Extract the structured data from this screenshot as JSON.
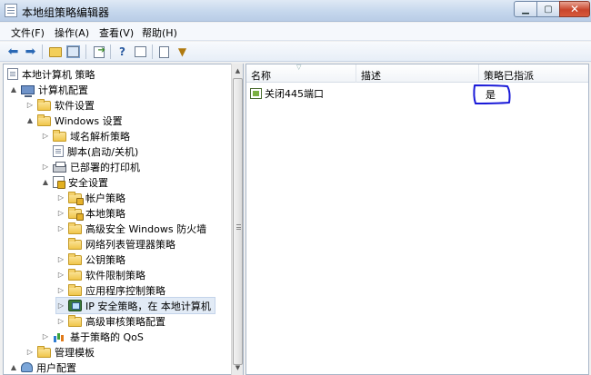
{
  "window": {
    "title": "本地组策略编辑器"
  },
  "menu": [
    {
      "label": "文件(F)"
    },
    {
      "label": "操作(A)"
    },
    {
      "label": "查看(V)"
    },
    {
      "label": "帮助(H)"
    }
  ],
  "toolbar": {
    "back_icon": "back-arrow-icon",
    "forward_icon": "forward-arrow-icon"
  },
  "tree": {
    "items": [
      {
        "label": "本地计算机 策略",
        "icon": "doc-icon",
        "expander": ""
      },
      {
        "label": "计算机配置",
        "icon": "computer-icon",
        "expander": "▲"
      },
      {
        "label": "软件设置",
        "icon": "folder-icon",
        "expander": "▷"
      },
      {
        "label": "Windows 设置",
        "icon": "folder-icon",
        "expander": "▲"
      },
      {
        "label": "域名解析策略",
        "icon": "folder-icon",
        "expander": "▷"
      },
      {
        "label": "脚本(启动/关机)",
        "icon": "script-icon",
        "expander": ""
      },
      {
        "label": "已部署的打印机",
        "icon": "printer-icon",
        "expander": "▷"
      },
      {
        "label": "安全设置",
        "icon": "security-icon",
        "expander": "▲"
      },
      {
        "label": "帐户策略",
        "icon": "lock-folder-icon",
        "expander": "▷"
      },
      {
        "label": "本地策略",
        "icon": "lock-folder-icon",
        "expander": "▷"
      },
      {
        "label": "高级安全 Windows 防火墙",
        "icon": "folder-icon",
        "expander": "▷"
      },
      {
        "label": "网络列表管理器策略",
        "icon": "folder-icon",
        "expander": ""
      },
      {
        "label": "公钥策略",
        "icon": "folder-icon",
        "expander": "▷"
      },
      {
        "label": "软件限制策略",
        "icon": "folder-icon",
        "expander": "▷"
      },
      {
        "label": "应用程序控制策略",
        "icon": "folder-icon",
        "expander": "▷"
      },
      {
        "label": "IP 安全策略，在 本地计算机",
        "icon": "network-icon",
        "expander": "▷"
      },
      {
        "label": "高级审核策略配置",
        "icon": "folder-icon",
        "expander": "▷"
      },
      {
        "label": "基于策略的 QoS",
        "icon": "chart-icon",
        "expander": "▷"
      },
      {
        "label": "管理模板",
        "icon": "folder-icon",
        "expander": "▷"
      },
      {
        "label": "用户配置",
        "icon": "users-icon",
        "expander": "▲"
      }
    ]
  },
  "list": {
    "columns": [
      {
        "label": "名称"
      },
      {
        "label": "描述"
      },
      {
        "label": "策略已指派"
      }
    ],
    "rows": [
      {
        "name": "关闭445端口",
        "description": "",
        "assigned": "是"
      }
    ]
  },
  "colors": {
    "annotation": "#1a1ad8",
    "selection": "#e2ebf6"
  }
}
